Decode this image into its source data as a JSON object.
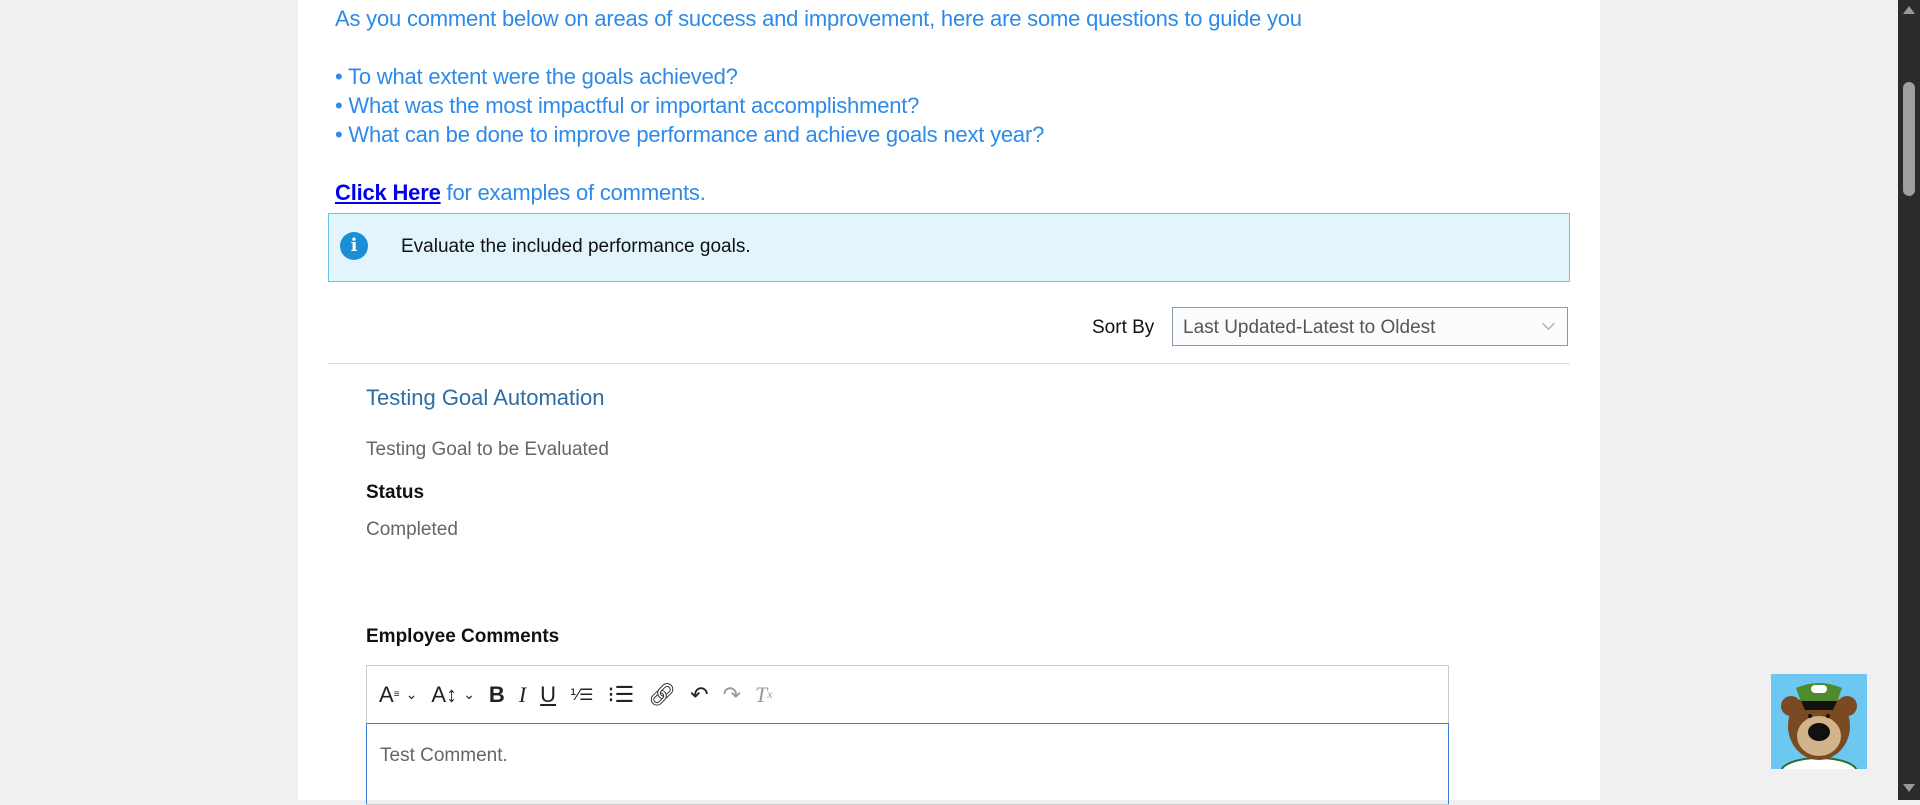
{
  "guidance": {
    "intro": "As you comment below on areas of success and improvement, here are some questions to guide you",
    "bullets": [
      "• To what extent were the goals achieved?",
      "• What was the most impactful or important accomplishment?",
      "• What can be done to improve performance and achieve goals next year?"
    ],
    "link_label": "Click Here",
    "link_suffix": " for examples of comments."
  },
  "info": {
    "text": "Evaluate the included performance goals.",
    "icon": "info-icon"
  },
  "sort": {
    "label": "Sort By",
    "selected": "Last Updated-Latest to Oldest"
  },
  "goal": {
    "title": "Testing Goal Automation",
    "description": "Testing Goal to be Evaluated",
    "status_label": "Status",
    "status_value": "Completed"
  },
  "comments": {
    "label": "Employee Comments",
    "value": "Test Comment.",
    "toolbar": [
      "font-format",
      "font-size",
      "bold",
      "italic",
      "underline",
      "ordered-list",
      "bullet-list",
      "link",
      "undo",
      "redo",
      "clear-formatting"
    ]
  },
  "colors": {
    "guide_text": "#2d8ae8",
    "title": "#2e6da4",
    "focus_border": "#3b7ddd",
    "info_bg": "#e3f5fc"
  }
}
